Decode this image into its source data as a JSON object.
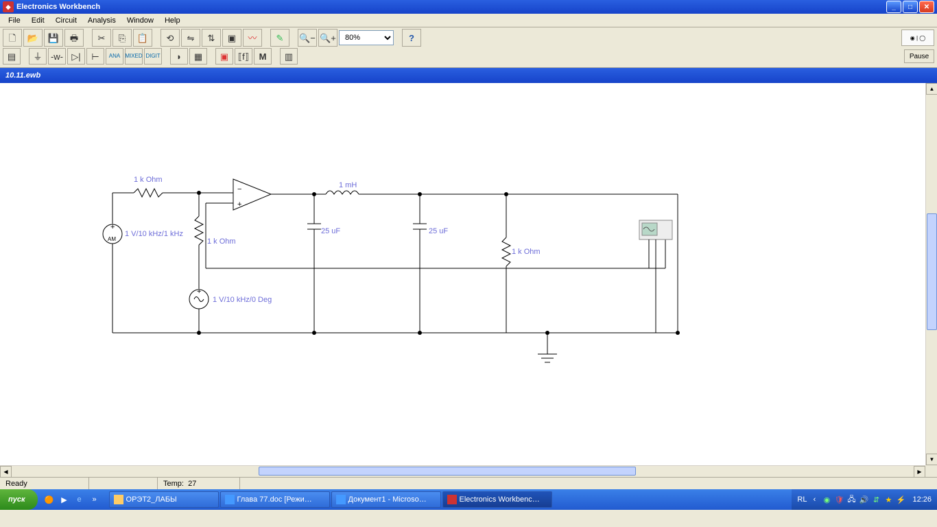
{
  "window": {
    "title": "Electronics Workbench"
  },
  "menu": {
    "items": [
      "File",
      "Edit",
      "Circuit",
      "Analysis",
      "Window",
      "Help"
    ]
  },
  "toolbar": {
    "zoom_value": "80%",
    "pause_label": "Pause"
  },
  "document": {
    "filename": "10.11.ewb"
  },
  "components": {
    "r1": "1 k Ohm",
    "r2": "1 k Ohm",
    "r3": "1 k Ohm",
    "c1": "25 uF",
    "c2": "25 uF",
    "l1": "1 mH",
    "src_am": "AM",
    "src_am_val": "1 V/10 kHz/1 kHz",
    "src_ac": "1 V/10 kHz/0 Deg",
    "plus": "+"
  },
  "status": {
    "ready": "Ready",
    "temp_label": "Temp:",
    "temp_value": "27"
  },
  "taskbar": {
    "start": "пуск",
    "lang": "RL",
    "clock": "12:26",
    "items": [
      {
        "label": "ОРЭТ2_ЛАБЫ"
      },
      {
        "label": "Глава 77.doc [Режи…"
      },
      {
        "label": "Документ1 - Microso…"
      },
      {
        "label": "Electronics Workbenc…"
      }
    ]
  }
}
